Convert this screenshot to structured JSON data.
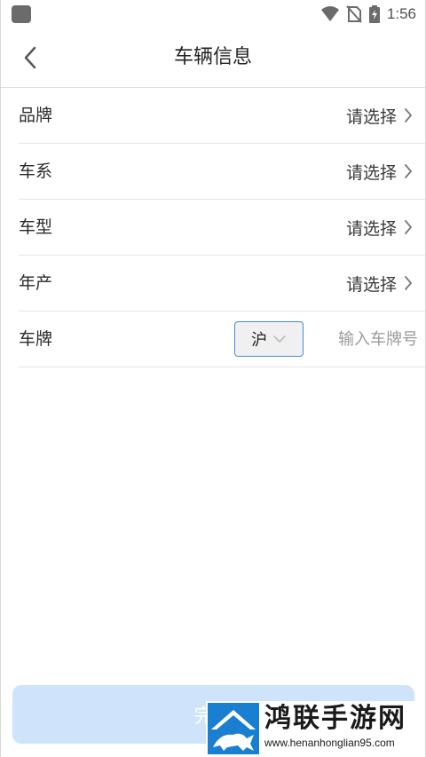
{
  "status_bar": {
    "time": "1:56",
    "icons": [
      "app-icon",
      "wifi-icon",
      "no-sim-icon",
      "battery-charging-icon"
    ]
  },
  "header": {
    "title": "车辆信息",
    "back_icon": "chevron-left-icon"
  },
  "form": {
    "rows": [
      {
        "label": "品牌",
        "value": "请选择"
      },
      {
        "label": "车系",
        "value": "请选择"
      },
      {
        "label": "车型",
        "value": "请选择"
      },
      {
        "label": "年产",
        "value": "请选择"
      }
    ],
    "plate": {
      "label": "车牌",
      "province": "沪",
      "placeholder": "输入车牌号",
      "value": ""
    }
  },
  "confirm_button": {
    "label": "完成"
  },
  "watermark": {
    "name": "鸿联手游网",
    "domain": "www.henanhonglian95.com"
  },
  "colors": {
    "accent": "#4a8ad6",
    "button_bg": "#cfe4fa",
    "divider": "#e6e6e6",
    "placeholder": "#9a9a9a"
  }
}
